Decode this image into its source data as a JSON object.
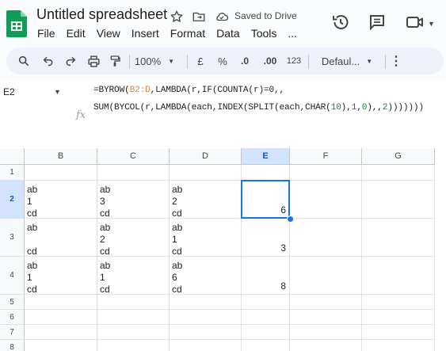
{
  "app": {
    "doc_title": "Untitled spreadsheet",
    "saved_status": "Saved to Drive",
    "menu": [
      "File",
      "Edit",
      "View",
      "Insert",
      "Format",
      "Data",
      "Tools",
      "..."
    ]
  },
  "toolbar": {
    "zoom": "100%",
    "currency": "£",
    "percent": "%",
    "dec_decrease": ".0",
    "dec_increase": ".00",
    "number_format": "123",
    "font": "Defaul..."
  },
  "formula_bar": {
    "name_box": "E2",
    "fx": "fx",
    "line1": {
      "a": "=BYROW(",
      "ref": "B2:D",
      "b": ",LAMBDA(r,IF(COUNTA(r)=0,,"
    },
    "line2": {
      "a": "SUM(BYCOL(r,LAMBDA(each,INDEX(SPLIT(each,CHAR(",
      "n1": "10",
      "b": "),",
      "n2": "1",
      "c": ",",
      "n3": "0",
      "d": "),,",
      "n4": "2",
      "e": ")))))))"
    }
  },
  "columns": [
    "B",
    "C",
    "D",
    "E",
    "F",
    "G"
  ],
  "selected_column": "E",
  "rows": [
    "1",
    "2",
    "3",
    "4",
    "5",
    "6",
    "7",
    "8"
  ],
  "selected_row": "2",
  "cells": {
    "B2": [
      "ab",
      "1",
      "cd"
    ],
    "C2": [
      "ab",
      "3",
      "cd"
    ],
    "D2": [
      "ab",
      "2",
      "cd"
    ],
    "E2": "6",
    "B3": [
      "ab",
      "",
      "cd"
    ],
    "C3": [
      "ab",
      "2",
      "cd"
    ],
    "D3": [
      "ab",
      "1",
      "cd"
    ],
    "E3": "3",
    "B4": [
      "ab",
      "1",
      "cd"
    ],
    "C4": [
      "ab",
      "1",
      "cd"
    ],
    "D4": [
      "ab",
      "6",
      "cd"
    ],
    "E4": "8"
  },
  "colors": {
    "accent": "#1a73e8",
    "sheets_green": "#0f9d58",
    "ref_orange": "#e2853c",
    "num_green": "#1a7f37"
  }
}
